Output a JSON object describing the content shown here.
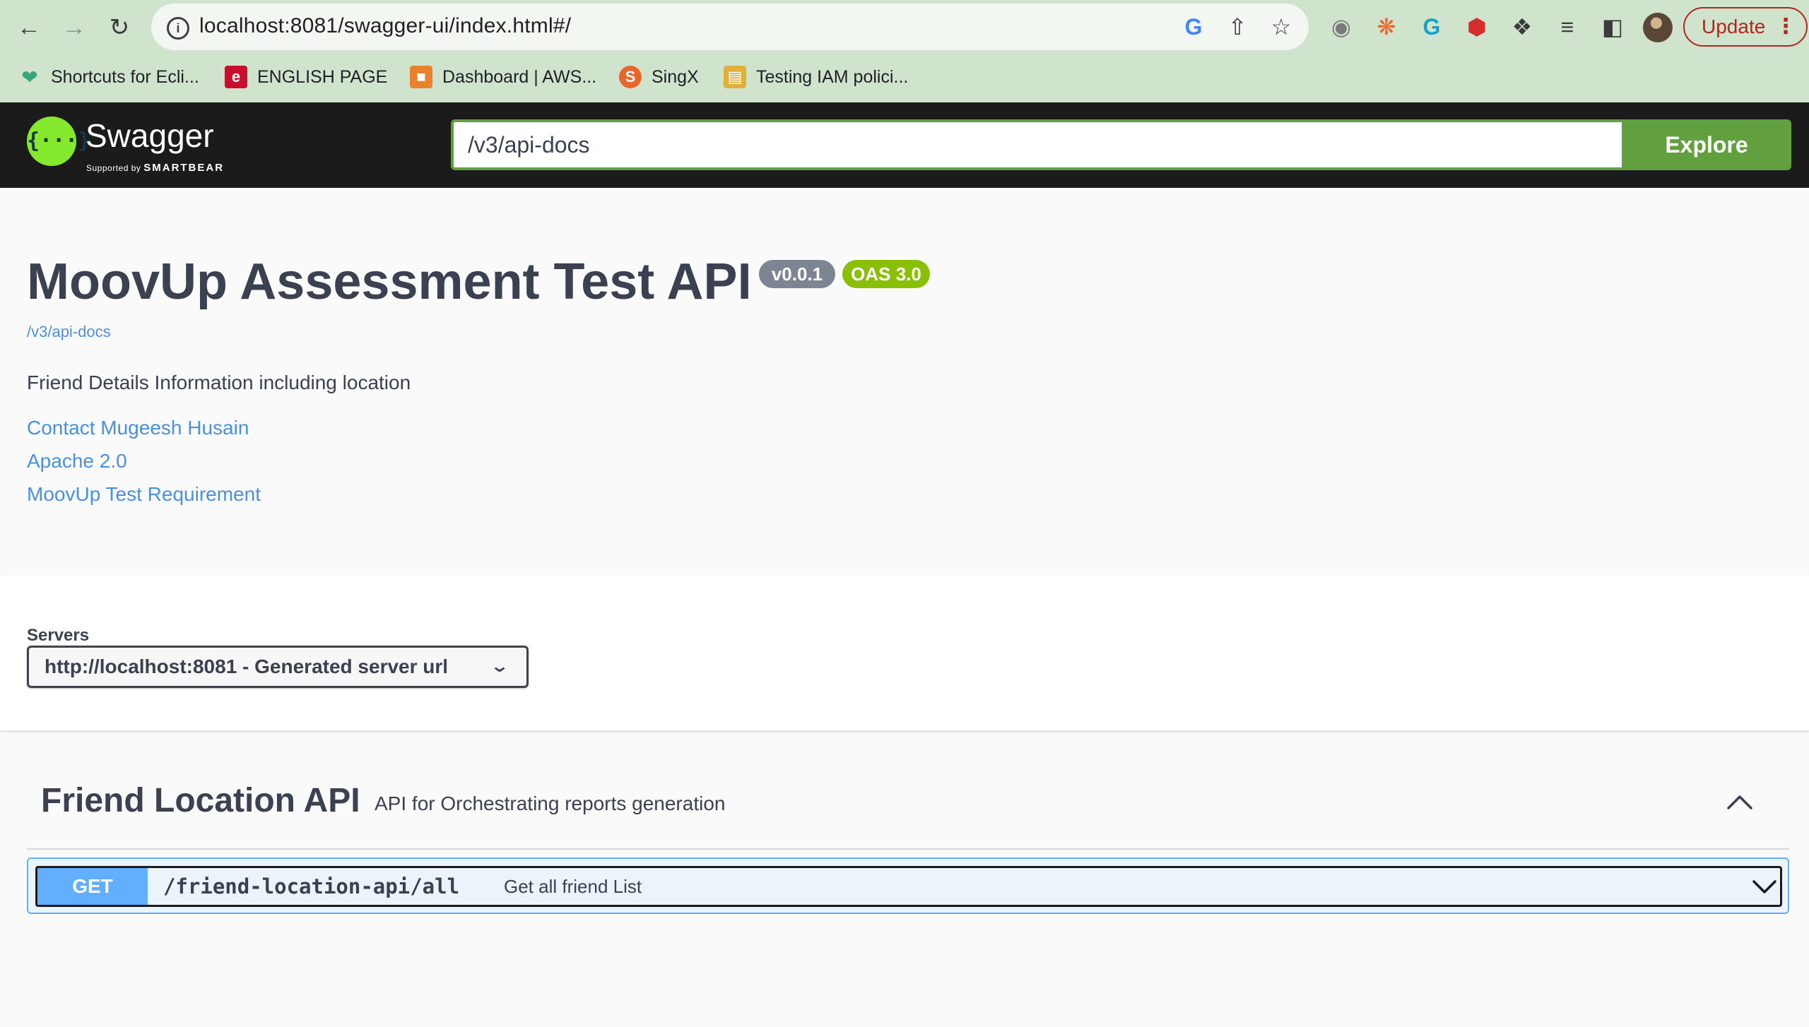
{
  "browser": {
    "url": "localhost:8081/swagger-ui/index.html#/",
    "update_label": "Update",
    "bookmarks": [
      {
        "label": "Shortcuts for Ecli...",
        "icon": "eclipse-icon",
        "color": "#3aa57a"
      },
      {
        "label": "ENGLISH PAGE",
        "icon": "e-letter-icon",
        "color": "#c8102e",
        "glyph": "e"
      },
      {
        "label": "Dashboard | AWS...",
        "icon": "aws-box-icon",
        "color": "#e8822c"
      },
      {
        "label": "SingX",
        "icon": "singx-icon",
        "color": "#e8662c",
        "glyph": "S"
      },
      {
        "label": "Testing IAM polici...",
        "icon": "document-icon",
        "color": "#e2b03a"
      }
    ]
  },
  "topbar": {
    "logo_text": "Swagger",
    "logo_sub_prefix": "Supported by",
    "logo_sub_brand": "SMARTBEAR",
    "logo_glyph": "{···}",
    "spec_url": "/v3/api-docs",
    "explore_label": "Explore"
  },
  "info": {
    "title": "MoovUp Assessment Test API",
    "version": "v0.0.1",
    "oas": "OAS 3.0",
    "spec_link": "/v3/api-docs",
    "description": "Friend Details Information including location",
    "links": [
      "Contact Mugeesh Husain",
      "Apache 2.0",
      "MoovUp Test Requirement"
    ]
  },
  "servers": {
    "label": "Servers",
    "selected": "http://localhost:8081 - Generated server url"
  },
  "tag": {
    "name": "Friend Location API",
    "description": "API for Orchestrating reports generation",
    "operations": [
      {
        "method": "GET",
        "path": "/friend-location-api/all",
        "summary": "Get all friend List"
      }
    ]
  },
  "colors": {
    "get": "#61affe",
    "topbar": "#1b1b1b",
    "explore": "#62a03f",
    "oas_badge": "#89bf04",
    "link": "#4990e2"
  }
}
